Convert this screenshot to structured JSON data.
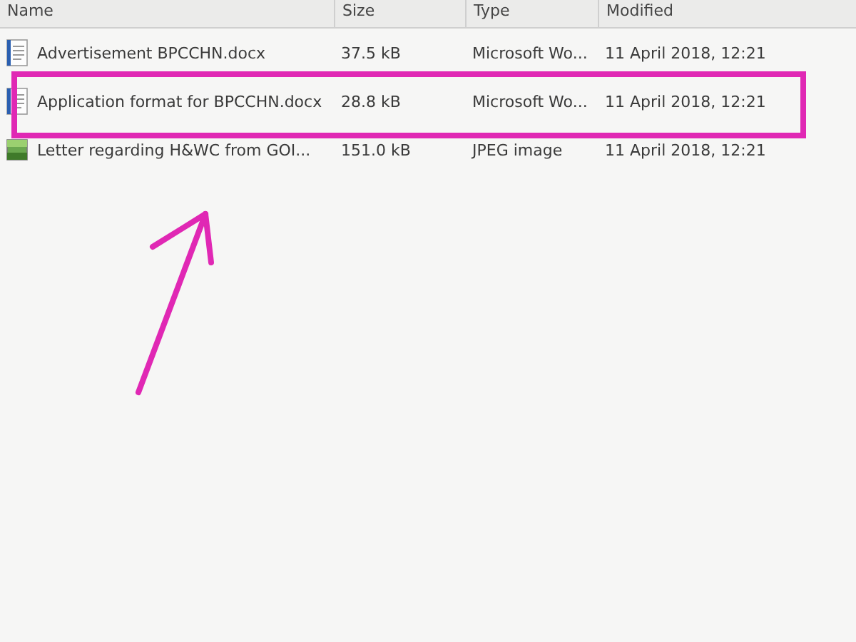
{
  "table": {
    "columns": [
      "Name",
      "Size",
      "Type",
      "Modified"
    ],
    "rows": [
      {
        "kind": "document",
        "cells": [
          "Advertisement BPCCHN.docx",
          "37.5 kB",
          "Microsoft Wo...",
          "11 April 2018, 12:21"
        ]
      },
      {
        "kind": "document",
        "cells": [
          "Application format for BPCCHN.docx",
          "28.8 kB",
          "Microsoft Wo...",
          "11 April 2018, 12:21"
        ]
      },
      {
        "kind": "image",
        "cells": [
          "Letter regarding H&WC from  GOI...",
          "151.0 kB",
          "JPEG image",
          "11 April 2018, 12:21"
        ]
      }
    ]
  }
}
